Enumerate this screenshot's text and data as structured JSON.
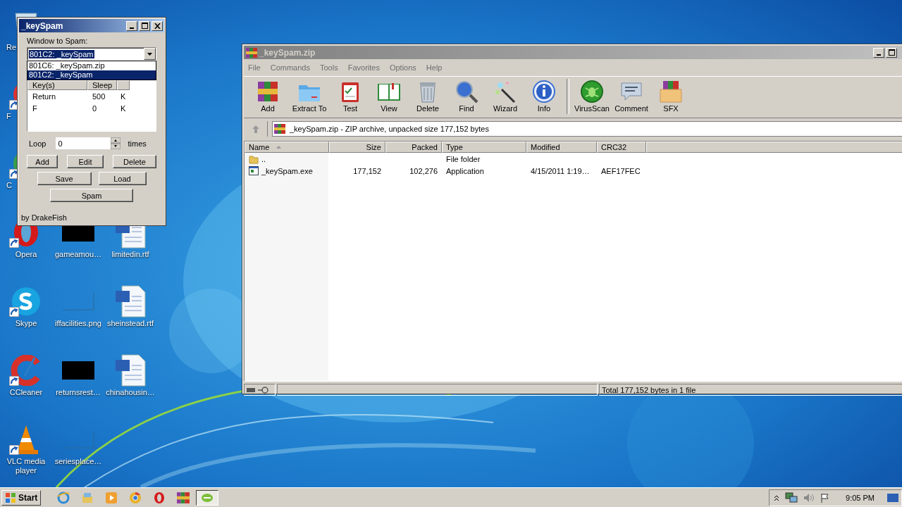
{
  "desktop": {
    "columns": [
      [
        {
          "label": "Re",
          "kind": "recycle",
          "shortcut": false
        },
        {
          "label": "F",
          "kind": "red-app",
          "shortcut": true
        },
        {
          "label": "C",
          "kind": "chrome",
          "shortcut": true
        },
        {
          "label": "Opera",
          "kind": "opera",
          "shortcut": true
        },
        {
          "label": "Skype",
          "kind": "skype",
          "shortcut": true
        },
        {
          "label": "CCleaner",
          "kind": "ccleaner",
          "shortcut": true
        },
        {
          "label": "VLC media player",
          "kind": "vlc",
          "shortcut": true
        }
      ],
      [
        {
          "label": "gameamou…",
          "kind": "thumb-dark",
          "shortcut": false
        },
        {
          "label": "iffacilities.png",
          "kind": "thumb-light",
          "shortcut": false
        },
        {
          "label": "returnsrest…",
          "kind": "thumb-dark",
          "shortcut": false
        },
        {
          "label": "seriesplace…",
          "kind": "thumb-light",
          "shortcut": false
        }
      ],
      [
        {
          "label": "limitedin.rtf",
          "kind": "word",
          "shortcut": false
        },
        {
          "label": "sheinstead.rtf",
          "kind": "word",
          "shortcut": false
        },
        {
          "label": "chinahousin…",
          "kind": "word",
          "shortcut": false
        }
      ]
    ]
  },
  "keyspam": {
    "title": "_keySpam",
    "target_label": "Window to Spam:",
    "target_value": "801C2: _keySpam",
    "target_options": [
      {
        "label": "801C6: _keySpam.zip",
        "selected": false
      },
      {
        "label": "801C2: _keySpam",
        "selected": true
      }
    ],
    "columns": [
      "Key(s)",
      "Sleep"
    ],
    "rows": [
      {
        "key": "Return",
        "sleep": "500",
        "mode": "K"
      },
      {
        "key": "F",
        "sleep": "0",
        "mode": "K"
      }
    ],
    "loop_label": "Loop",
    "loop_value": "0",
    "loop_unit": "times",
    "buttons": [
      [
        "Add",
        "Edit",
        "Delete"
      ],
      [
        "Save",
        "Load"
      ],
      [
        "Spam"
      ]
    ],
    "footer": "by DrakeFish"
  },
  "winrar": {
    "title": "_keySpam.zip",
    "menu": [
      "File",
      "Commands",
      "Tools",
      "Favorites",
      "Options",
      "Help"
    ],
    "toolbar": [
      [
        {
          "label": "Add",
          "kind": "add"
        },
        {
          "label": "Extract To",
          "kind": "extract"
        },
        {
          "label": "Test",
          "kind": "test"
        },
        {
          "label": "View",
          "kind": "view"
        },
        {
          "label": "Delete",
          "kind": "delete"
        },
        {
          "label": "Find",
          "kind": "find"
        },
        {
          "label": "Wizard",
          "kind": "wizard"
        },
        {
          "label": "Info",
          "kind": "info"
        }
      ],
      [
        {
          "label": "VirusScan",
          "kind": "virusscan"
        },
        {
          "label": "Comment",
          "kind": "comment"
        },
        {
          "label": "SFX",
          "kind": "sfx"
        }
      ]
    ],
    "address": "_keySpam.zip - ZIP archive, unpacked size 177,152 bytes",
    "columns": [
      {
        "label": "Name",
        "sorted": true
      },
      {
        "label": "Size",
        "sorted": false
      },
      {
        "label": "Packed",
        "sorted": false
      },
      {
        "label": "Type",
        "sorted": false
      },
      {
        "label": "Modified",
        "sorted": false
      },
      {
        "label": "CRC32",
        "sorted": false
      }
    ],
    "rows": [
      {
        "kind": "folder",
        "cells": [
          "..",
          "",
          "",
          "File folder",
          "",
          ""
        ]
      },
      {
        "kind": "exe",
        "cells": [
          "_keySpam.exe",
          "177,152",
          "102,276",
          "Application",
          "4/15/2011 1:19…",
          "AEF17FEC"
        ]
      }
    ],
    "status": "Total 177,152 bytes in 1 file"
  },
  "taskbar": {
    "start": "Start",
    "apps": [
      {
        "kind": "ie",
        "active": false
      },
      {
        "kind": "explorer",
        "active": false
      },
      {
        "kind": "media",
        "active": false
      },
      {
        "kind": "chrome",
        "active": false
      },
      {
        "kind": "opera",
        "active": false
      },
      {
        "kind": "winrar",
        "active": false
      },
      {
        "kind": "keyspam",
        "active": true
      }
    ],
    "time": "9:05 PM"
  }
}
